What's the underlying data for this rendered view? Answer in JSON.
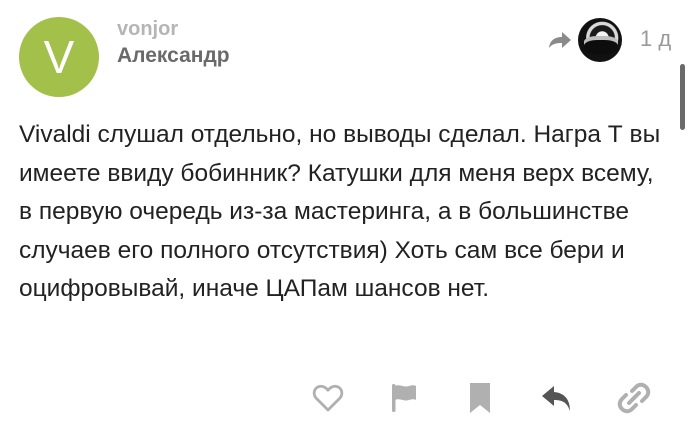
{
  "post": {
    "avatar_letter": "V",
    "avatar_color": "#a2c04a",
    "username": "vonjor",
    "full_name": "Александр",
    "reply_to_icon": "share-arrow-icon",
    "date": "1 д",
    "body": "Vivaldi слушал отдельно, но выводы сделал. Награ Т вы имеете ввиду бобинник? Катушки для меня верх всему, в первую очередь из-за мастеринга, а в большинстве случаев его полного отсутствия) Хоть сам все бери и оцифровывай, иначе ЦАПам шансов нет."
  },
  "actions": [
    {
      "icon": "heart-icon"
    },
    {
      "icon": "flag-icon"
    },
    {
      "icon": "bookmark-icon"
    },
    {
      "icon": "reply-icon"
    },
    {
      "icon": "link-icon"
    }
  ],
  "colors": {
    "text": "#222222",
    "muted": "#9a9a9a",
    "icon": "#b0b0b0",
    "reply_icon": "#555555"
  }
}
